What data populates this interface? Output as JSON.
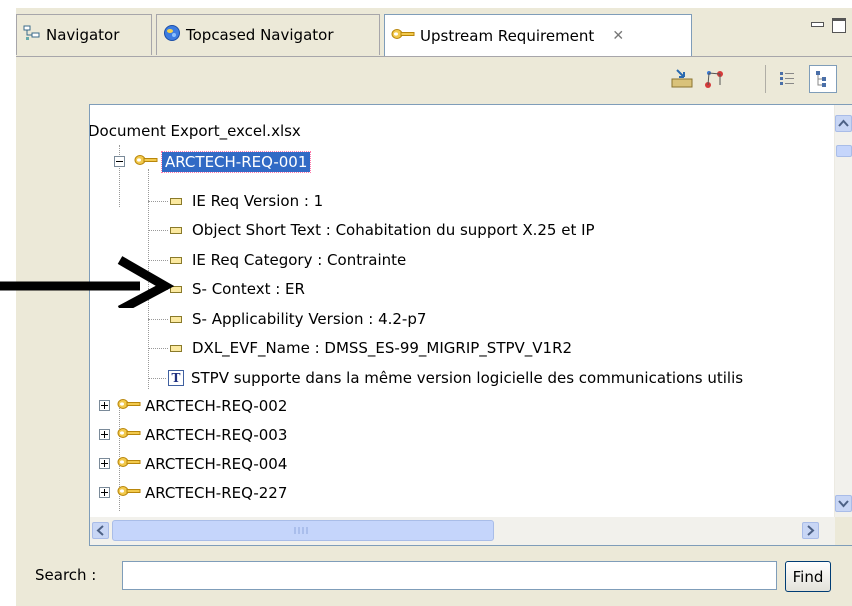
{
  "tabs": [
    {
      "label": "Navigator",
      "icon": "navigator-icon"
    },
    {
      "label": "Topcased Navigator",
      "icon": "topcased-globe-icon"
    },
    {
      "label": "Upstream Requirement",
      "icon": "key-icon",
      "active": true,
      "close": "✕"
    }
  ],
  "tree": {
    "root": "Document Export_excel.xlsx",
    "selected": "ARCTECH-REQ-001",
    "attributes": [
      "IE Req Version : 1",
      "Object Short Text : Cohabitation du support X.25 et IP",
      "IE Req Category : Contrainte",
      "S- Context : ER",
      "S- Applicability Version : 4.2-p7",
      "DXL_EVF_Name : DMSS_ES-99_MIGRIP_STPV_V1R2"
    ],
    "text_node": "STPV supporte dans la même version logicielle des communications utilis",
    "text_icon_letter": "T",
    "collapsed": [
      "ARCTECH-REQ-002",
      "ARCTECH-REQ-003",
      "ARCTECH-REQ-004",
      "ARCTECH-REQ-227"
    ]
  },
  "search": {
    "label": "Search :",
    "value": "",
    "button": "Find"
  },
  "colors": {
    "selection": "#316ac5",
    "panel": "#ece9d8",
    "border": "#7f9db9"
  }
}
